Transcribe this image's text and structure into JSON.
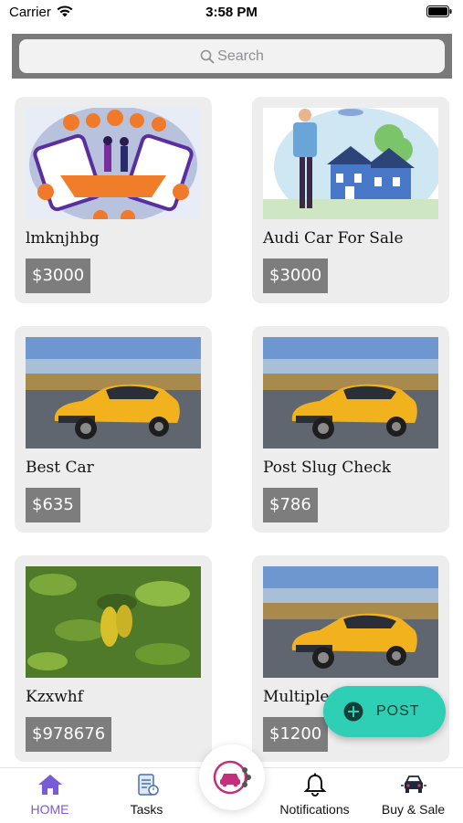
{
  "status_bar": {
    "carrier": "Carrier",
    "time": "3:58 PM"
  },
  "search": {
    "placeholder": "Search"
  },
  "listings": [
    {
      "title": "lmknjhbg",
      "price": "$3000",
      "image": "shopping-illustration"
    },
    {
      "title": "Audi Car For Sale",
      "price": "$3000",
      "image": "man-with-house-illustration"
    },
    {
      "title": "Best Car",
      "price": "$635",
      "image": "yellow-sports-car"
    },
    {
      "title": "Post Slug Check",
      "price": "$786",
      "image": "yellow-sports-car"
    },
    {
      "title": "Kzxwhf",
      "price": "$978676",
      "image": "green-leaves-fruit"
    },
    {
      "title": "Multiple",
      "price": "$1200",
      "image": "yellow-sports-car"
    }
  ],
  "fab": {
    "label": "POST",
    "icon": "plus-circle-icon"
  },
  "tabbar": {
    "items": [
      {
        "label": "HOME",
        "icon": "home-icon"
      },
      {
        "label": "Tasks",
        "icon": "tasks-icon"
      },
      {
        "label": "Notifications",
        "icon": "bell-icon"
      },
      {
        "label": "Buy & Sale",
        "icon": "car-sale-icon"
      }
    ],
    "center_icon": "car-share-icon"
  },
  "colors": {
    "accent": "#7a5bd6",
    "fab": "#2ecfb4",
    "price_bg": "#7d7d7d",
    "card_bg": "#ededed",
    "center_pink": "#c2307a"
  }
}
